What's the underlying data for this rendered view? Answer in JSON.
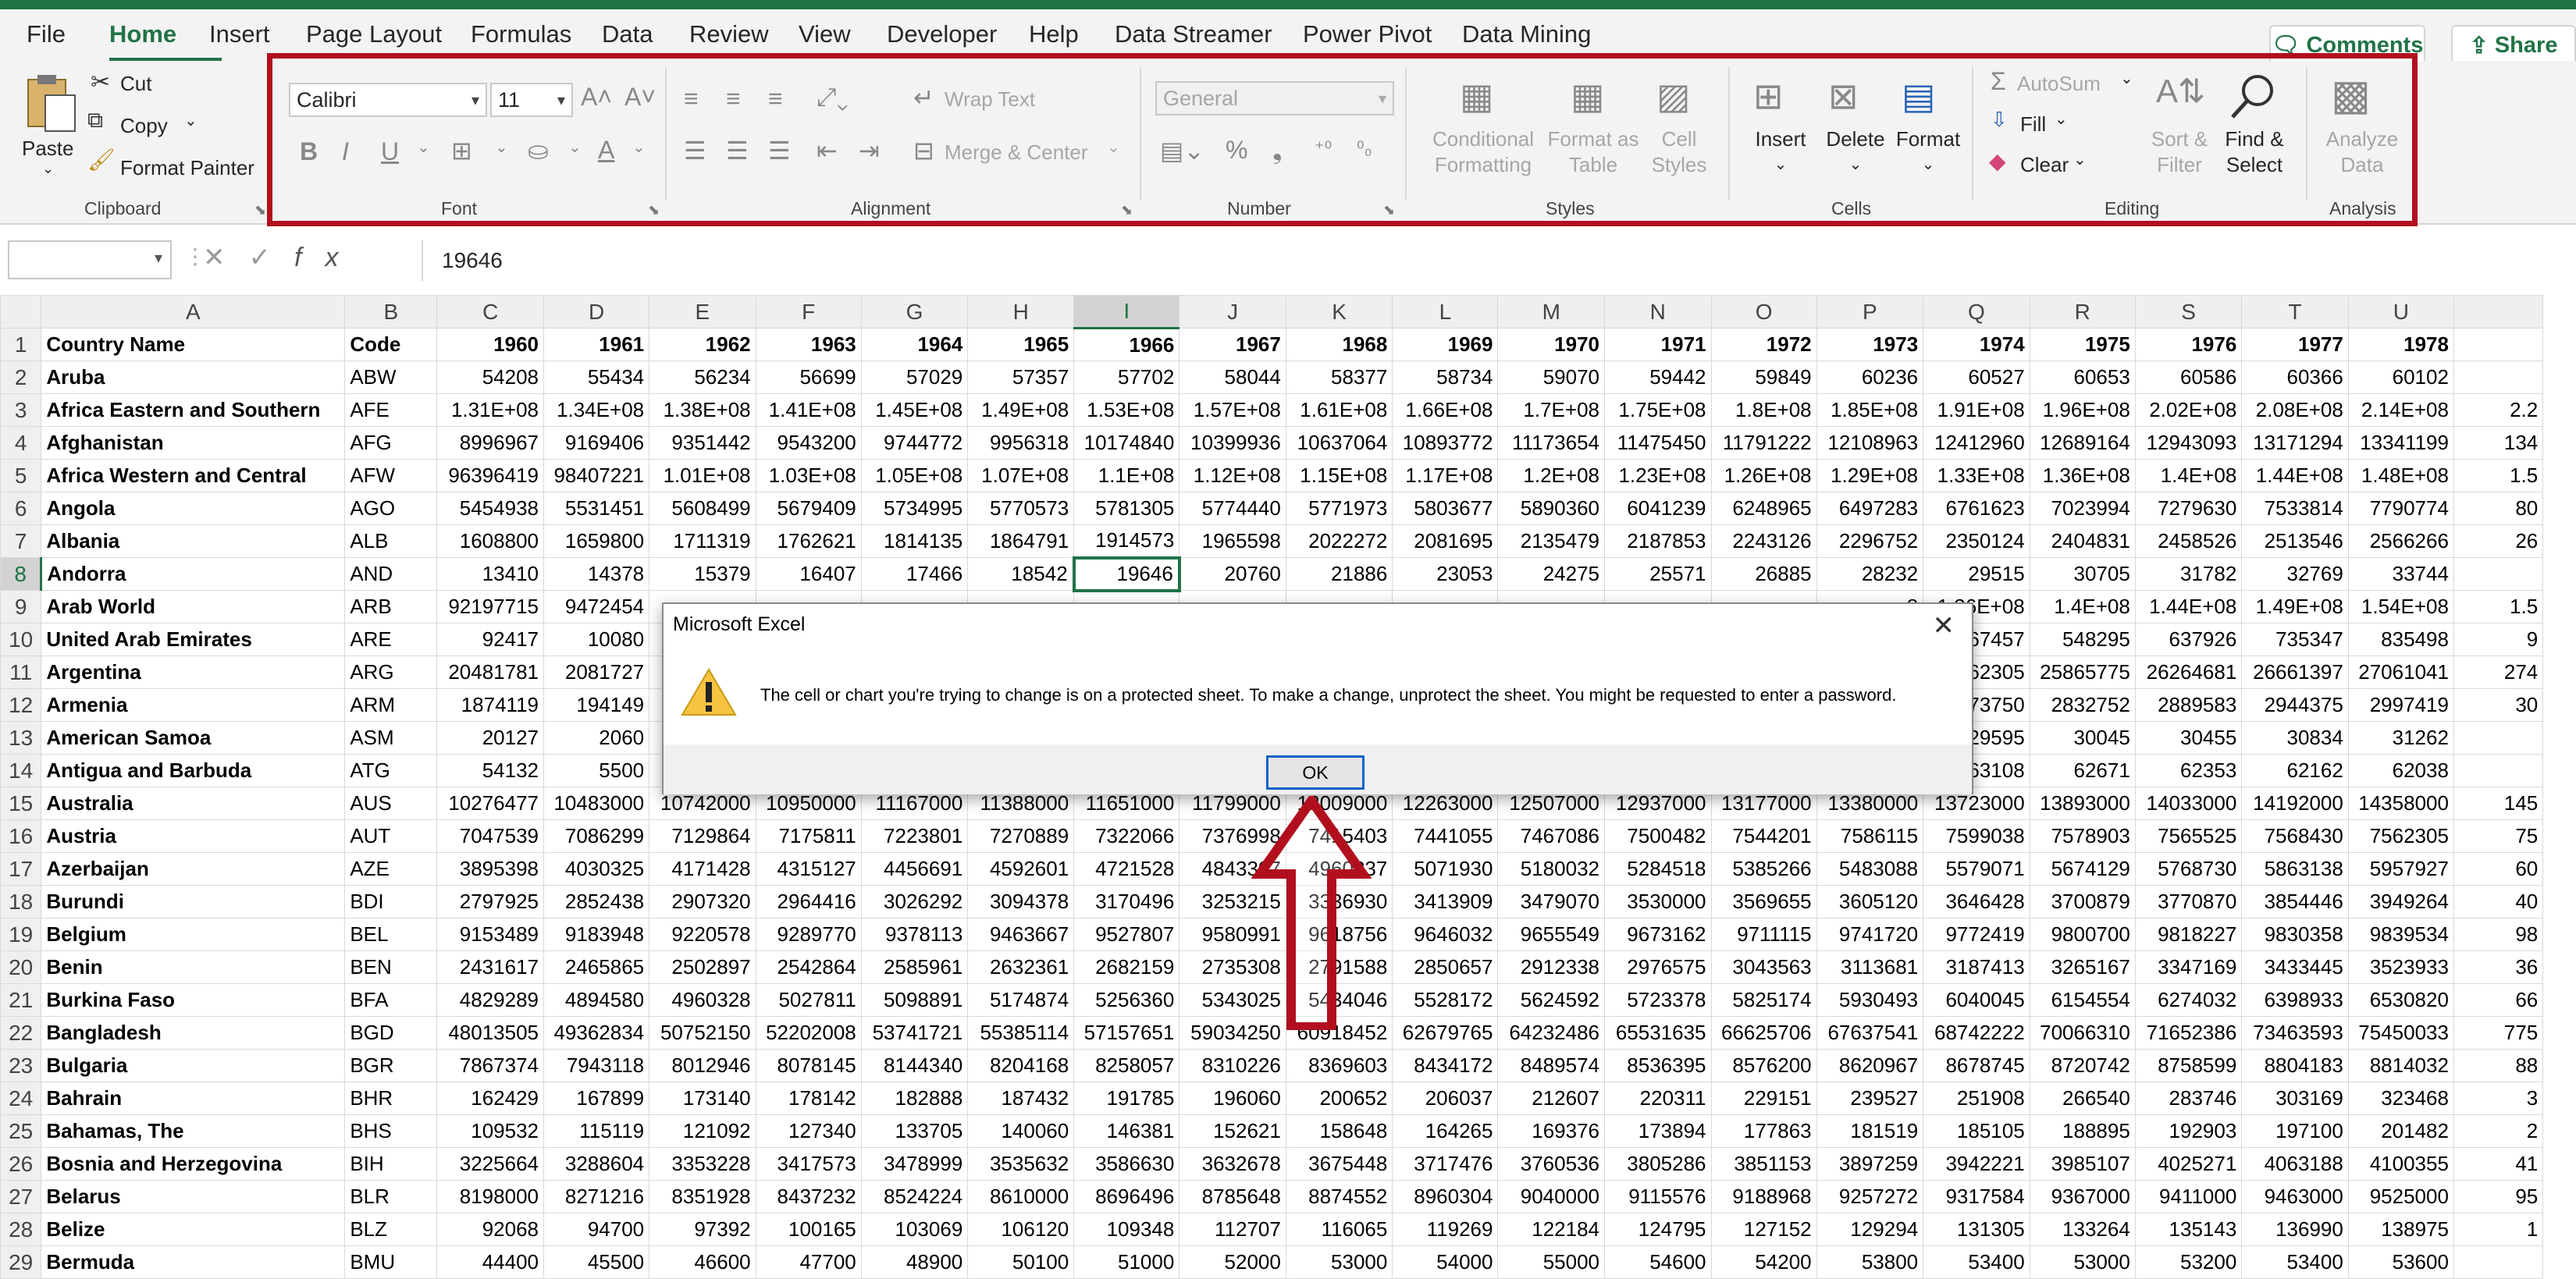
{
  "tabs": [
    {
      "label": "File"
    },
    {
      "label": "Home"
    },
    {
      "label": "Insert"
    },
    {
      "label": "Page Layout"
    },
    {
      "label": "Formulas"
    },
    {
      "label": "Data"
    },
    {
      "label": "Review"
    },
    {
      "label": "View"
    },
    {
      "label": "Developer"
    },
    {
      "label": "Help"
    },
    {
      "label": "Data Streamer"
    },
    {
      "label": "Power Pivot"
    },
    {
      "label": "Data Mining"
    }
  ],
  "header": {
    "comments": "Comments",
    "share": "Share"
  },
  "ribbon": {
    "clipboard": {
      "paste": "Paste",
      "cut": "Cut",
      "copy": "Copy",
      "format_painter": "Format Painter",
      "label": "Clipboard"
    },
    "font": {
      "name": "Calibri",
      "size": "11",
      "label": "Font"
    },
    "alignment": {
      "wrap": "Wrap Text",
      "merge": "Merge & Center",
      "label": "Alignment"
    },
    "number": {
      "format": "General",
      "label": "Number"
    },
    "styles": {
      "conditional_1": "Conditional",
      "conditional_2": "Formatting",
      "format_table_1": "Format as",
      "format_table_2": "Table",
      "cell_styles_1": "Cell",
      "cell_styles_2": "Styles",
      "label": "Styles"
    },
    "cells": {
      "insert": "Insert",
      "delete": "Delete",
      "format": "Format",
      "label": "Cells"
    },
    "editing": {
      "autosum": "AutoSum",
      "fill": "Fill",
      "clear": "Clear",
      "sort_1": "Sort &",
      "sort_2": "Filter",
      "find_1": "Find &",
      "find_2": "Select",
      "label": "Editing"
    },
    "analysis": {
      "analyze_1": "Analyze",
      "analyze_2": "Data",
      "label": "Analysis"
    }
  },
  "formula_bar": {
    "name_box": "",
    "value": "19646"
  },
  "sheet": {
    "columns": [
      "A",
      "B",
      "C",
      "D",
      "E",
      "F",
      "G",
      "H",
      "I",
      "J",
      "K",
      "L",
      "M",
      "N",
      "O",
      "P",
      "Q",
      "R",
      "S",
      "T",
      "U",
      ""
    ],
    "rows": [
      [
        "Country Name",
        "Code",
        "1960",
        "1961",
        "1962",
        "1963",
        "1964",
        "1965",
        "1966",
        "1967",
        "1968",
        "1969",
        "1970",
        "1971",
        "1972",
        "1973",
        "1974",
        "1975",
        "1976",
        "1977",
        "1978",
        ""
      ],
      [
        "Aruba",
        "ABW",
        "54208",
        "55434",
        "56234",
        "56699",
        "57029",
        "57357",
        "57702",
        "58044",
        "58377",
        "58734",
        "59070",
        "59442",
        "59849",
        "60236",
        "60527",
        "60653",
        "60586",
        "60366",
        "60102",
        ""
      ],
      [
        "Africa Eastern and Southern",
        "AFE",
        "1.31E+08",
        "1.34E+08",
        "1.38E+08",
        "1.41E+08",
        "1.45E+08",
        "1.49E+08",
        "1.53E+08",
        "1.57E+08",
        "1.61E+08",
        "1.66E+08",
        "1.7E+08",
        "1.75E+08",
        "1.8E+08",
        "1.85E+08",
        "1.91E+08",
        "1.96E+08",
        "2.02E+08",
        "2.08E+08",
        "2.14E+08",
        "2.2"
      ],
      [
        "Afghanistan",
        "AFG",
        "8996967",
        "9169406",
        "9351442",
        "9543200",
        "9744772",
        "9956318",
        "10174840",
        "10399936",
        "10637064",
        "10893772",
        "11173654",
        "11475450",
        "11791222",
        "12108963",
        "12412960",
        "12689164",
        "12943093",
        "13171294",
        "13341199",
        "134"
      ],
      [
        "Africa Western and Central",
        "AFW",
        "96396419",
        "98407221",
        "1.01E+08",
        "1.03E+08",
        "1.05E+08",
        "1.07E+08",
        "1.1E+08",
        "1.12E+08",
        "1.15E+08",
        "1.17E+08",
        "1.2E+08",
        "1.23E+08",
        "1.26E+08",
        "1.29E+08",
        "1.33E+08",
        "1.36E+08",
        "1.4E+08",
        "1.44E+08",
        "1.48E+08",
        "1.5"
      ],
      [
        "Angola",
        "AGO",
        "5454938",
        "5531451",
        "5608499",
        "5679409",
        "5734995",
        "5770573",
        "5781305",
        "5774440",
        "5771973",
        "5803677",
        "5890360",
        "6041239",
        "6248965",
        "6497283",
        "6761623",
        "7023994",
        "7279630",
        "7533814",
        "7790774",
        "80"
      ],
      [
        "Albania",
        "ALB",
        "1608800",
        "1659800",
        "1711319",
        "1762621",
        "1814135",
        "1864791",
        "1914573",
        "1965598",
        "2022272",
        "2081695",
        "2135479",
        "2187853",
        "2243126",
        "2296752",
        "2350124",
        "2404831",
        "2458526",
        "2513546",
        "2566266",
        "26"
      ],
      [
        "Andorra",
        "AND",
        "13410",
        "14378",
        "15379",
        "16407",
        "17466",
        "18542",
        "19646",
        "20760",
        "21886",
        "23053",
        "24275",
        "25571",
        "26885",
        "28232",
        "29515",
        "30705",
        "31782",
        "32769",
        "33744",
        ""
      ],
      [
        "Arab World",
        "ARB",
        "92197715",
        "9472454",
        "",
        "",
        "",
        "",
        "",
        "",
        "",
        "",
        "",
        "",
        "",
        "8",
        "1.36E+08",
        "1.4E+08",
        "1.44E+08",
        "1.49E+08",
        "1.54E+08",
        "1.5"
      ],
      [
        "United Arab Emirates",
        "ARE",
        "92417",
        "10080",
        "",
        "",
        "",
        "",
        "",
        "",
        "",
        "",
        "",
        "",
        "",
        "5",
        "467457",
        "548295",
        "637926",
        "735347",
        "835498",
        "9"
      ],
      [
        "Argentina",
        "ARG",
        "20481781",
        "2081727",
        "",
        "",
        "",
        "",
        "",
        "",
        "",
        "",
        "",
        "",
        "",
        "5",
        "25462305",
        "25865775",
        "26264681",
        "26661397",
        "27061041",
        "274"
      ],
      [
        "Armenia",
        "ARM",
        "1874119",
        "194149",
        "",
        "",
        "",
        "",
        "",
        "",
        "",
        "",
        "",
        "",
        "",
        "0",
        "2773750",
        "2832752",
        "2889583",
        "2944375",
        "2997419",
        "30"
      ],
      [
        "American Samoa",
        "ASM",
        "20127",
        "2060",
        "",
        "",
        "",
        "",
        "",
        "",
        "",
        "",
        "",
        "",
        "",
        "",
        "29595",
        "30045",
        "30455",
        "30834",
        "31262",
        ""
      ],
      [
        "Antigua and Barbuda",
        "ATG",
        "54132",
        "5500",
        "",
        "",
        "",
        "",
        "",
        "",
        "",
        "",
        "",
        "",
        "",
        "9",
        "63108",
        "62671",
        "62353",
        "62162",
        "62038",
        ""
      ],
      [
        "Australia",
        "AUS",
        "10276477",
        "10483000",
        "10742000",
        "10950000",
        "11167000",
        "11388000",
        "11651000",
        "11799000",
        "12009000",
        "12263000",
        "12507000",
        "12937000",
        "13177000",
        "13380000",
        "13723000",
        "13893000",
        "14033000",
        "14192000",
        "14358000",
        "145"
      ],
      [
        "Austria",
        "AUT",
        "7047539",
        "7086299",
        "7129864",
        "7175811",
        "7223801",
        "7270889",
        "7322066",
        "7376998",
        "7415403",
        "7441055",
        "7467086",
        "7500482",
        "7544201",
        "7586115",
        "7599038",
        "7578903",
        "7565525",
        "7568430",
        "7562305",
        "75"
      ],
      [
        "Azerbaijan",
        "AZE",
        "3895398",
        "4030325",
        "4171428",
        "4315127",
        "4456691",
        "4592601",
        "4721528",
        "4843307",
        "4960237",
        "5071930",
        "5180032",
        "5284518",
        "5385266",
        "5483088",
        "5579071",
        "5674129",
        "5768730",
        "5863138",
        "5957927",
        "60"
      ],
      [
        "Burundi",
        "BDI",
        "2797925",
        "2852438",
        "2907320",
        "2964416",
        "3026292",
        "3094378",
        "3170496",
        "3253215",
        "3336930",
        "3413909",
        "3479070",
        "3530000",
        "3569655",
        "3605120",
        "3646428",
        "3700879",
        "3770870",
        "3854446",
        "3949264",
        "40"
      ],
      [
        "Belgium",
        "BEL",
        "9153489",
        "9183948",
        "9220578",
        "9289770",
        "9378113",
        "9463667",
        "9527807",
        "9580991",
        "9618756",
        "9646032",
        "9655549",
        "9673162",
        "9711115",
        "9741720",
        "9772419",
        "9800700",
        "9818227",
        "9830358",
        "9839534",
        "98"
      ],
      [
        "Benin",
        "BEN",
        "2431617",
        "2465865",
        "2502897",
        "2542864",
        "2585961",
        "2632361",
        "2682159",
        "2735308",
        "2791588",
        "2850657",
        "2912338",
        "2976575",
        "3043563",
        "3113681",
        "3187413",
        "3265167",
        "3347169",
        "3433445",
        "3523933",
        "36"
      ],
      [
        "Burkina Faso",
        "BFA",
        "4829289",
        "4894580",
        "4960328",
        "5027811",
        "5098891",
        "5174874",
        "5256360",
        "5343025",
        "5434046",
        "5528172",
        "5624592",
        "5723378",
        "5825174",
        "5930493",
        "6040045",
        "6154554",
        "6274032",
        "6398933",
        "6530820",
        "66"
      ],
      [
        "Bangladesh",
        "BGD",
        "48013505",
        "49362834",
        "50752150",
        "52202008",
        "53741721",
        "55385114",
        "57157651",
        "59034250",
        "60918452",
        "62679765",
        "64232486",
        "65531635",
        "66625706",
        "67637541",
        "68742222",
        "70066310",
        "71652386",
        "73463593",
        "75450033",
        "775"
      ],
      [
        "Bulgaria",
        "BGR",
        "7867374",
        "7943118",
        "8012946",
        "8078145",
        "8144340",
        "8204168",
        "8258057",
        "8310226",
        "8369603",
        "8434172",
        "8489574",
        "8536395",
        "8576200",
        "8620967",
        "8678745",
        "8720742",
        "8758599",
        "8804183",
        "8814032",
        "88"
      ],
      [
        "Bahrain",
        "BHR",
        "162429",
        "167899",
        "173140",
        "178142",
        "182888",
        "187432",
        "191785",
        "196060",
        "200652",
        "206037",
        "212607",
        "220311",
        "229151",
        "239527",
        "251908",
        "266540",
        "283746",
        "303169",
        "323468",
        "3"
      ],
      [
        "Bahamas, The",
        "BHS",
        "109532",
        "115119",
        "121092",
        "127340",
        "133705",
        "140060",
        "146381",
        "152621",
        "158648",
        "164265",
        "169376",
        "173894",
        "177863",
        "181519",
        "185105",
        "188895",
        "192903",
        "197100",
        "201482",
        "2"
      ],
      [
        "Bosnia and Herzegovina",
        "BIH",
        "3225664",
        "3288604",
        "3353228",
        "3417573",
        "3478999",
        "3535632",
        "3586630",
        "3632678",
        "3675448",
        "3717476",
        "3760536",
        "3805286",
        "3851153",
        "3897259",
        "3942221",
        "3985107",
        "4025271",
        "4063188",
        "4100355",
        "41"
      ],
      [
        "Belarus",
        "BLR",
        "8198000",
        "8271216",
        "8351928",
        "8437232",
        "8524224",
        "8610000",
        "8696496",
        "8785648",
        "8874552",
        "8960304",
        "9040000",
        "9115576",
        "9188968",
        "9257272",
        "9317584",
        "9367000",
        "9411000",
        "9463000",
        "9525000",
        "95"
      ],
      [
        "Belize",
        "BLZ",
        "92068",
        "94700",
        "97392",
        "100165",
        "103069",
        "106120",
        "109348",
        "112707",
        "116065",
        "119269",
        "122184",
        "124795",
        "127152",
        "129294",
        "131305",
        "133264",
        "135143",
        "136990",
        "138975",
        "1"
      ],
      [
        "Bermuda",
        "BMU",
        "44400",
        "45500",
        "46600",
        "47700",
        "48900",
        "50100",
        "51000",
        "52000",
        "53000",
        "54000",
        "55000",
        "54600",
        "54200",
        "53800",
        "53400",
        "53000",
        "53200",
        "53400",
        "53600",
        ""
      ]
    ]
  },
  "dialog": {
    "title": "Microsoft Excel",
    "message": "The cell or chart you're trying to change is on a protected sheet. To make a change, unprotect the sheet. You might be requested to enter a password.",
    "ok": "OK"
  },
  "colors": {
    "excel_green": "#217346",
    "highlight_red": "#b20f1e",
    "ok_border": "#0a64c8"
  }
}
